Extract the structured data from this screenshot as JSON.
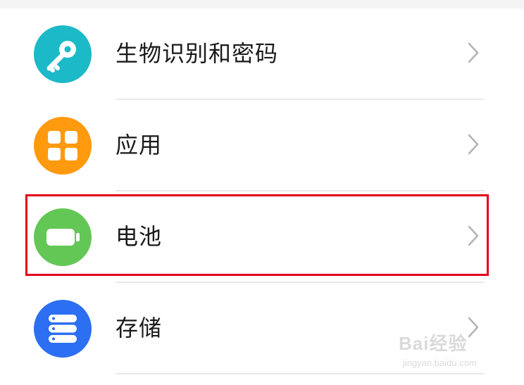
{
  "colors": {
    "security_icon_bg": "#1cb9c8",
    "apps_icon_bg": "#ff9a0f",
    "battery_icon_bg": "#63c755",
    "storage_icon_bg": "#2c6ff2",
    "highlight_border": "#e3001b"
  },
  "settings": {
    "items": [
      {
        "label": "生物识别和密码",
        "icon": "key-icon"
      },
      {
        "label": "应用",
        "icon": "grid-apps-icon"
      },
      {
        "label": "电池",
        "icon": "battery-icon"
      },
      {
        "label": "存储",
        "icon": "storage-icon"
      }
    ]
  },
  "watermark": {
    "main": "Bai经验",
    "sub": "jingyan.baidu.com"
  }
}
